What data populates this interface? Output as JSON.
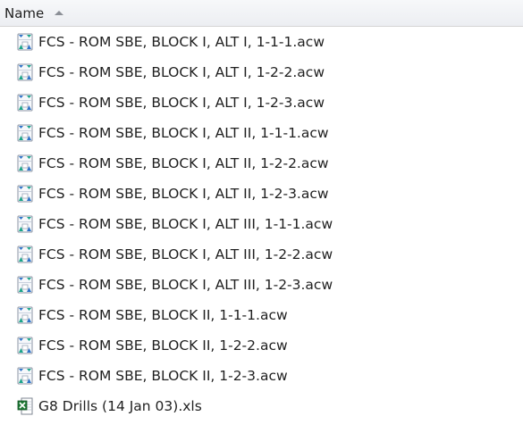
{
  "header": {
    "name_label": "Name",
    "sort_icon": "sort-ascending-icon"
  },
  "files": [
    {
      "name": "FCS - ROM SBE, BLOCK I, ALT I, 1-1-1.acw",
      "icon": "acw-file-icon"
    },
    {
      "name": "FCS - ROM SBE, BLOCK I, ALT I, 1-2-2.acw",
      "icon": "acw-file-icon"
    },
    {
      "name": "FCS - ROM SBE, BLOCK I, ALT I, 1-2-3.acw",
      "icon": "acw-file-icon"
    },
    {
      "name": "FCS - ROM SBE, BLOCK I, ALT II, 1-1-1.acw",
      "icon": "acw-file-icon"
    },
    {
      "name": "FCS - ROM SBE, BLOCK I, ALT II, 1-2-2.acw",
      "icon": "acw-file-icon"
    },
    {
      "name": "FCS - ROM SBE, BLOCK I, ALT II, 1-2-3.acw",
      "icon": "acw-file-icon"
    },
    {
      "name": "FCS - ROM SBE, BLOCK I, ALT III, 1-1-1.acw",
      "icon": "acw-file-icon"
    },
    {
      "name": "FCS - ROM SBE, BLOCK I, ALT III, 1-2-2.acw",
      "icon": "acw-file-icon"
    },
    {
      "name": "FCS - ROM SBE, BLOCK I, ALT III, 1-2-3.acw",
      "icon": "acw-file-icon"
    },
    {
      "name": "FCS - ROM SBE, BLOCK II, 1-1-1.acw",
      "icon": "acw-file-icon"
    },
    {
      "name": "FCS - ROM SBE, BLOCK II, 1-2-2.acw",
      "icon": "acw-file-icon"
    },
    {
      "name": "FCS - ROM SBE, BLOCK II, 1-2-3.acw",
      "icon": "acw-file-icon"
    },
    {
      "name": "G8 Drills (14 Jan 03).xls",
      "icon": "excel-file-icon"
    }
  ],
  "colors": {
    "acw_icon_blue": "#2f73c8",
    "acw_icon_teal": "#1aa58a",
    "excel_icon_green": "#1f7a36"
  }
}
